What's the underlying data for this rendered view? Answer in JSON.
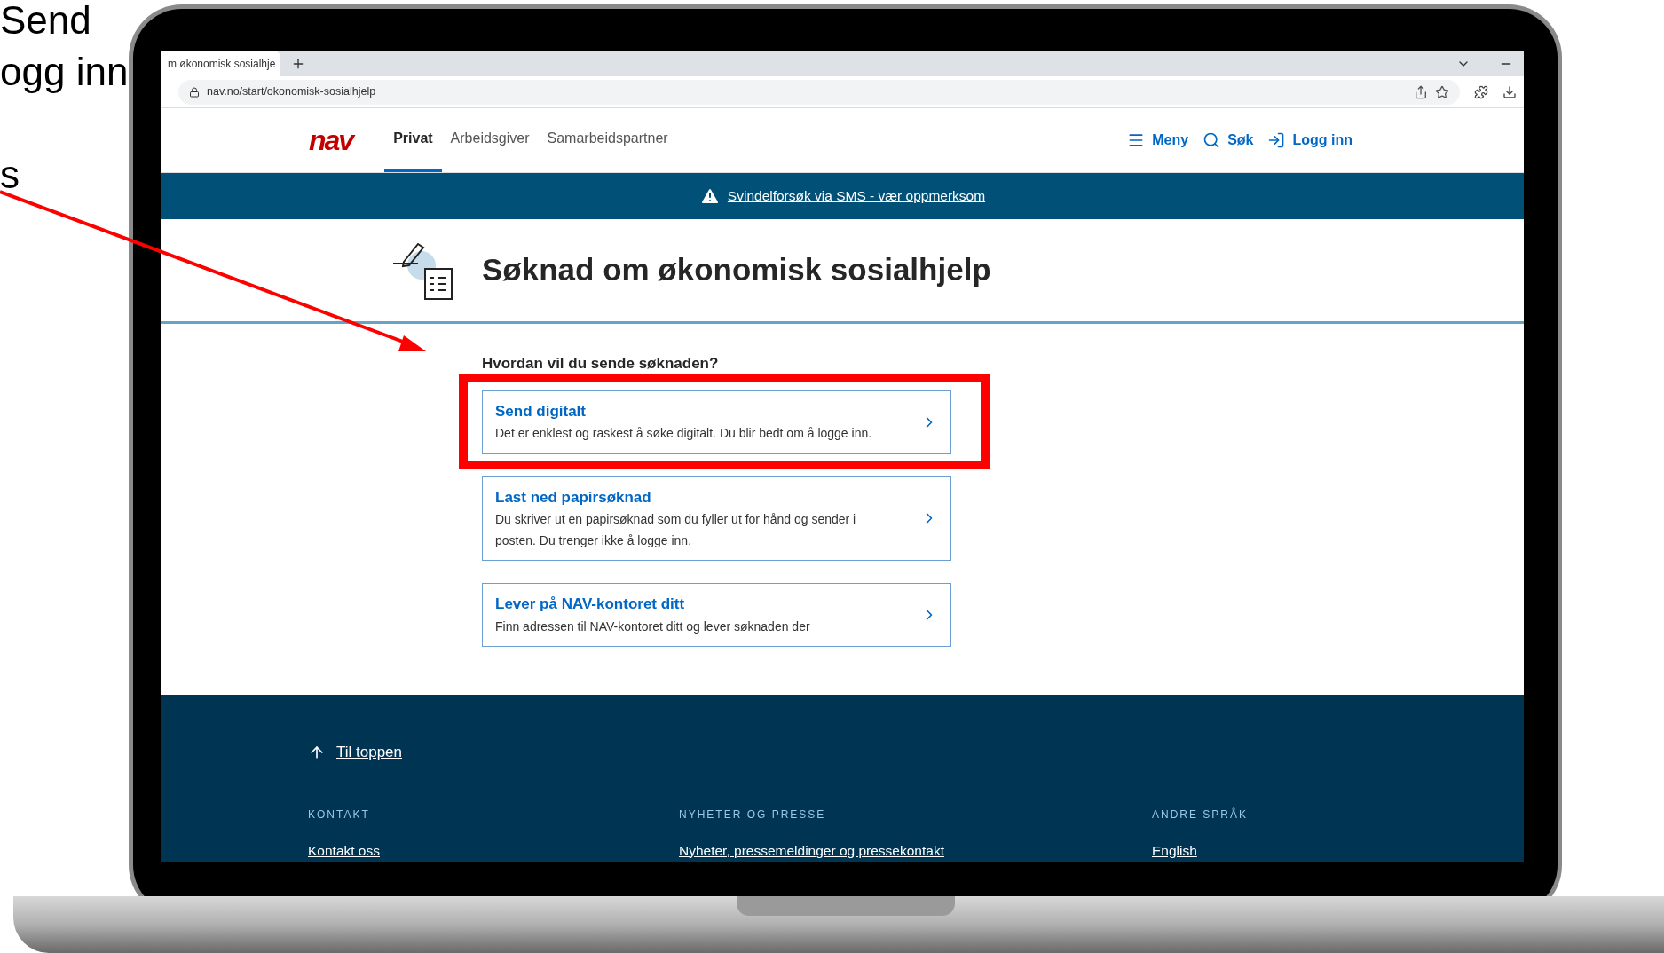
{
  "slide_text": [
    "Send",
    "ogg inn",
    "s"
  ],
  "browser": {
    "tab_title": "m økonomisk sosialhje",
    "url": "nav.no/start/okonomisk-sosialhjelp"
  },
  "nav": {
    "logo": "nav",
    "tabs": [
      {
        "label": "Privat",
        "selected": true
      },
      {
        "label": "Arbeidsgiver",
        "selected": false
      },
      {
        "label": "Samarbeidspartner",
        "selected": false
      }
    ],
    "actions": [
      {
        "kind": "menu",
        "label": "Meny"
      },
      {
        "kind": "search",
        "label": "Søk"
      },
      {
        "kind": "login",
        "label": "Logg inn"
      }
    ]
  },
  "alert": "Svindelforsøk via SMS - vær oppmerksom",
  "title": "Søknad om økonomisk sosialhjelp",
  "question": "Hvordan vil du sende søknaden?",
  "options": [
    {
      "title": "Send digitalt",
      "description": "Det er enklest og raskest å søke digitalt. Du blir bedt om å logge inn."
    },
    {
      "title": "Last ned papirsøknad",
      "description": "Du skriver ut en papirsøknad som du fyller ut for hånd og sender i posten. Du trenger ikke å logge inn."
    },
    {
      "title": "Lever på NAV-kontoret ditt",
      "description": "Finn adressen til NAV-kontoret ditt og lever søknaden der"
    }
  ],
  "pointer_arrow": true,
  "highlight_box": true,
  "footer": {
    "to_top": "Til toppen",
    "columns": [
      {
        "heading": "KONTAKT",
        "link": "Kontakt oss"
      },
      {
        "heading": "NYHETER OG PRESSE",
        "link": "Nyheter, pressemeldinger og pressekontakt"
      },
      {
        "heading": "ANDRE SPRÅK",
        "link": "English"
      }
    ]
  }
}
